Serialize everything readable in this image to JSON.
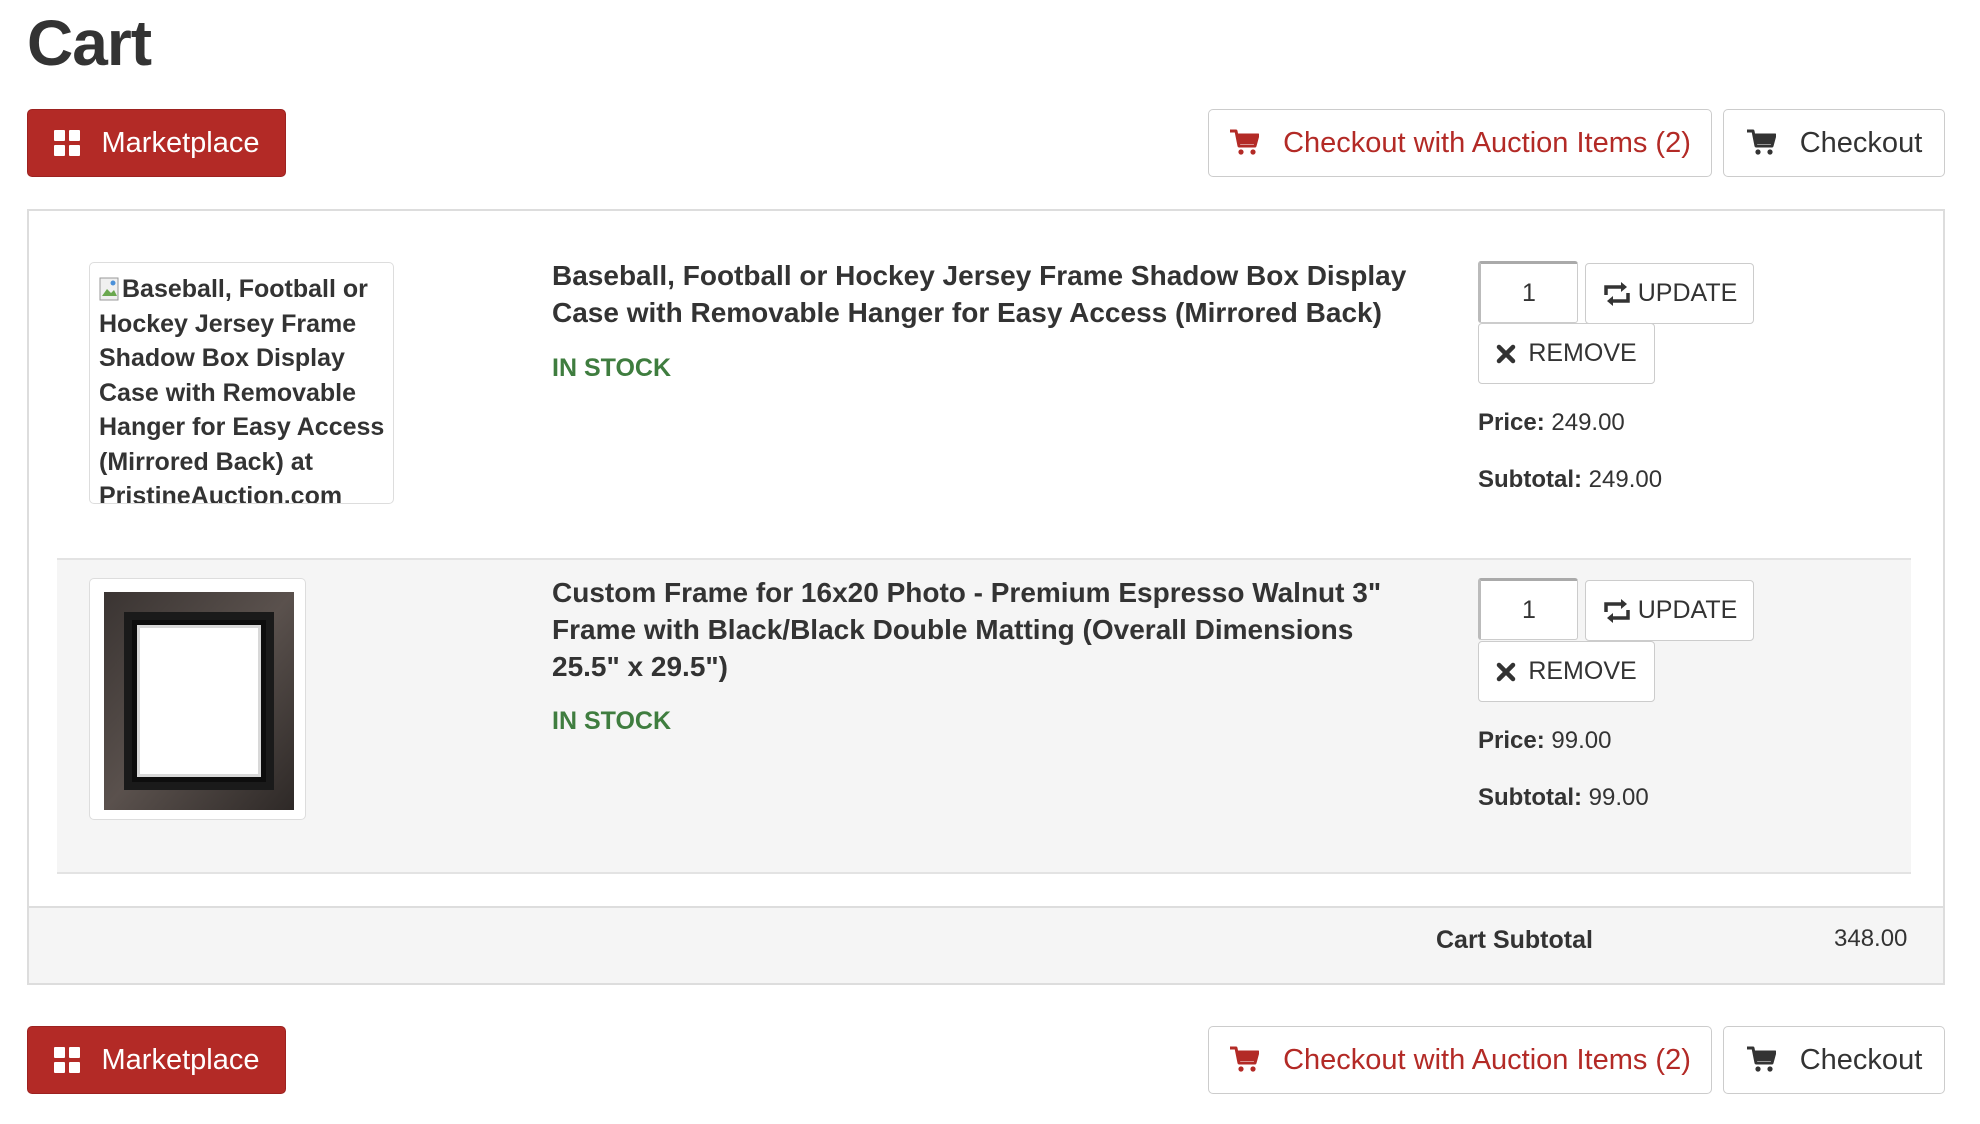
{
  "page": {
    "title": "Cart"
  },
  "toolbar": {
    "marketplace_label": "Marketplace",
    "auction_checkout_label": "Checkout with Auction Items (2)",
    "checkout_label": "Checkout"
  },
  "items": [
    {
      "name": "Baseball, Football or Hockey Jersey Frame Shadow Box Display Case with Removable Hanger for Easy Access (Mirrored Back)",
      "image_alt": "Baseball, Football or Hockey Jersey Frame Shadow Box Display Case with Removable Hanger for Easy Access (Mirrored Back) at PristineAuction.com",
      "stock": "IN STOCK",
      "quantity": "1",
      "update_label": "UPDATE",
      "remove_label": "REMOVE",
      "price_label": "Price:",
      "price": "249.00",
      "subtotal_label": "Subtotal:",
      "subtotal": "249.00"
    },
    {
      "name": "Custom Frame for 16x20 Photo - Premium Espresso Walnut 3\" Frame with Black/Black Double Matting (Overall Dimensions 25.5\" x 29.5\")",
      "stock": "IN STOCK",
      "quantity": "1",
      "update_label": "UPDATE",
      "remove_label": "REMOVE",
      "price_label": "Price:",
      "price": "99.00",
      "subtotal_label": "Subtotal:",
      "subtotal": "99.00"
    }
  ],
  "summary": {
    "cart_subtotal_label": "Cart Subtotal",
    "cart_subtotal_value": "348.00"
  },
  "colors": {
    "brand_red": "#b32a26",
    "in_stock_green": "#3f7d3f",
    "row_alt_bg": "#f5f5f5"
  },
  "icons": {
    "marketplace": "grid-icon",
    "checkout": "cart-icon",
    "update": "refresh-icon",
    "remove": "x-icon"
  }
}
